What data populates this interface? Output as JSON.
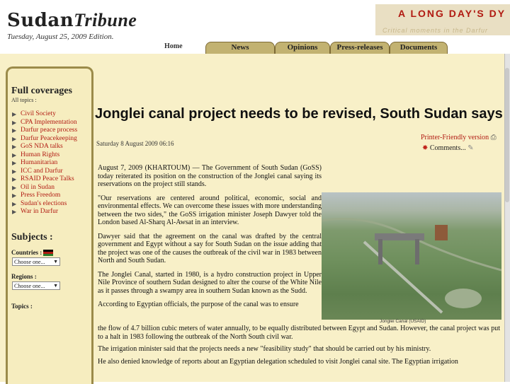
{
  "masthead": {
    "logo_sudan": "Sudan",
    "logo_tribune": "Tribune",
    "edition": "Tuesday, August 25, 2009 Edition.",
    "banner_title": "A LONG DAY'S DY",
    "banner_subtitle": "Critical moments in the Darfur"
  },
  "nav": {
    "home": "Home",
    "tabs": [
      "News",
      "Opinions",
      "Press-releases",
      "Documents"
    ]
  },
  "sidebar": {
    "heading": "Full coverages",
    "all_topics": "All topics :",
    "items": [
      "Civil Society",
      "CPA Implementation",
      "Darfur peace process",
      "Darfur Peacekeeping",
      "GoS NDA talks",
      "Human Rights",
      "Humanitarian",
      "ICC and Darfur",
      "RSAID Peace Talks",
      "Oil in Sudan",
      "Press Freedom",
      "Sudan's elections",
      "War in Darfur"
    ],
    "subjects": "Subjects :",
    "countries_label": "Countries :",
    "select_placeholder": "Choose one...",
    "regions_label": "Regions :",
    "topics_label": "Topics :"
  },
  "article": {
    "headline": "Jonglei canal project needs to be revised, South Sudan says",
    "date": "Saturday 8 August 2009 06:16",
    "printer_friendly": "Printer-Friendly version",
    "comments": "Comments...",
    "paragraphs": [
      "August 7, 2009 (KHARTOUM) — The Government of South Sudan (GoSS) today reiterated its position on the construction of the Jonglei canal saying its reservations on the project still stands.",
      "\"Our reservations are centered around political, economic, social and environmental effects. We can overcome these issues with more understanding between the two sides,\" the GoSS irrigation minister Joseph Dawyer told the London based Al-Sharq Al-Awsat in an interview.",
      "Dawyer said that the agreement on the canal was drafted by the central government and Egypt without a say for South Sudan on the issue adding that the project was one of the causes the outbreak of the civil war in 1983 between North and South Sudan.",
      "The Jonglei Canal, started in 1980, is a hydro construction project in Upper Nile Province of southern Sudan designed to alter the course of the White Nile as it passes through a swampy area in southern Sudan known as the Sudd.",
      "According to Egyptian officials, the purpose of the canal was to ensure"
    ],
    "wide_paragraphs": [
      "the flow of 4.7 billion cubic meters of water annually, to be equally distributed between Egypt and Sudan. However, the canal project was put to a halt in 1983 following the outbreak of the North South civil war.",
      "The irrigation minister said that the projects needs a new \"feasibility study\" that should be carried out by his ministry.",
      "He also denied knowledge of reports about an Egyptian delegation scheduled to visit Jonglei canal site. The Egyptian irrigation"
    ],
    "photo_caption": "Jonglei Canal (USAID)"
  }
}
